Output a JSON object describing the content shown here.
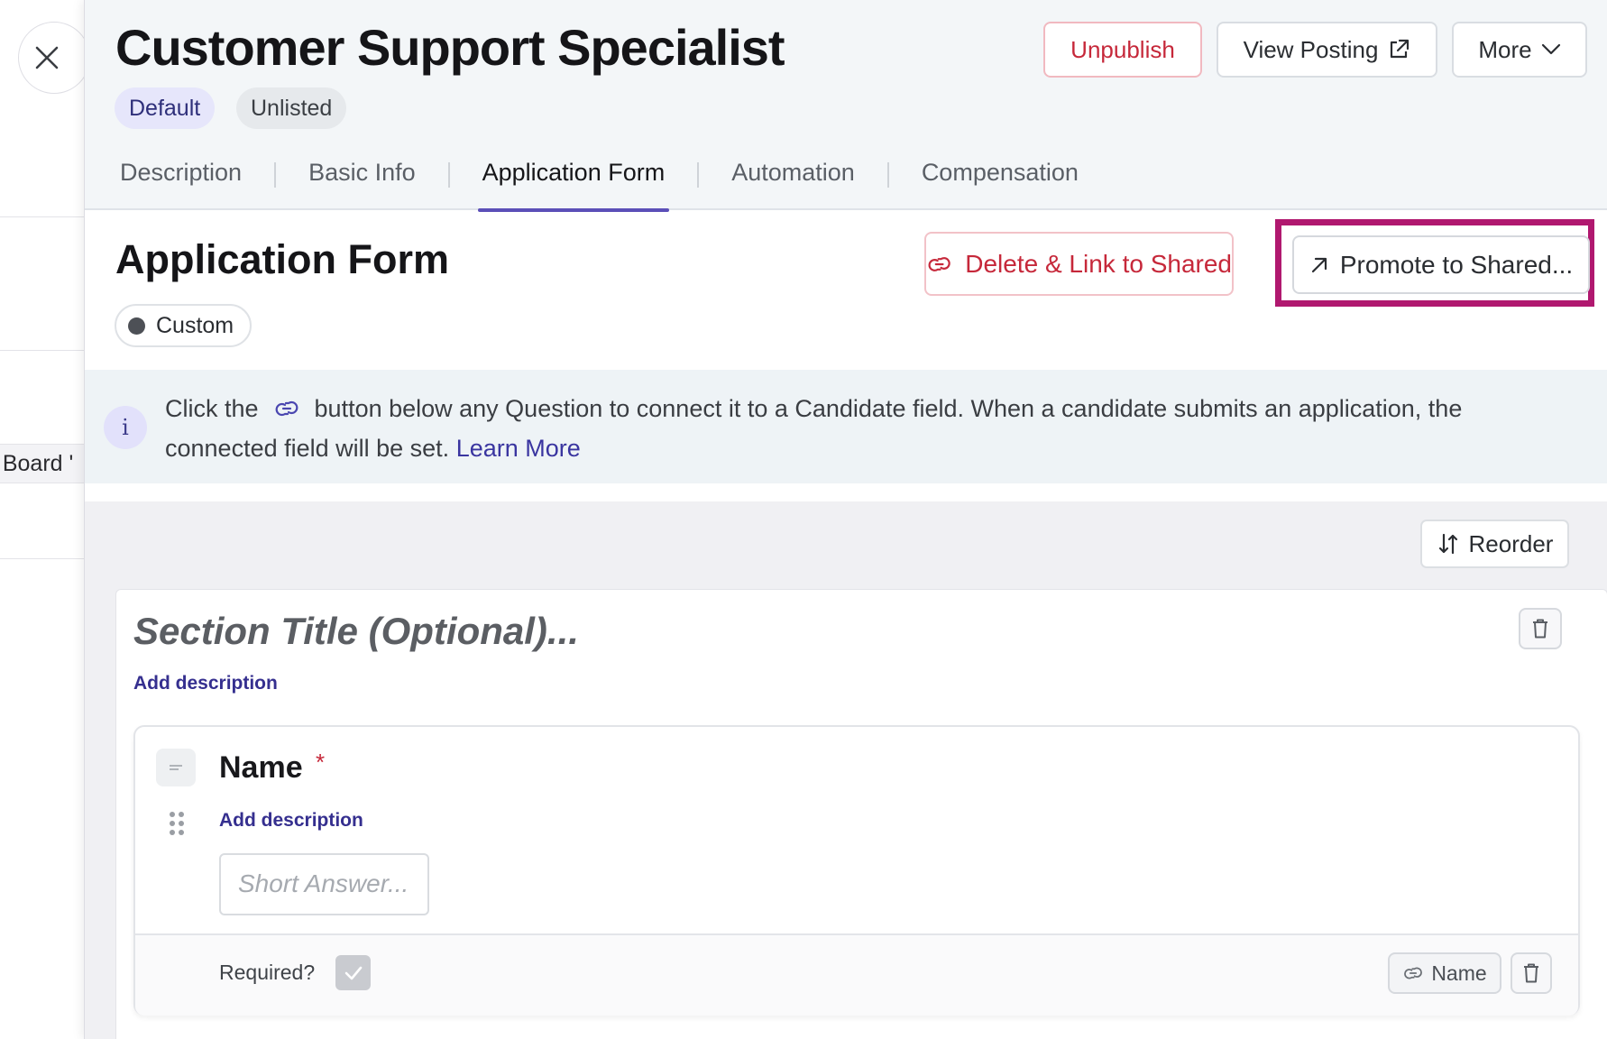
{
  "background": {
    "board_label": "b Board '"
  },
  "header": {
    "title": "Customer Support Specialist",
    "tags": [
      "Default",
      "Unlisted"
    ],
    "buttons": {
      "unpublish": "Unpublish",
      "view_posting": "View Posting",
      "more": "More"
    },
    "tabs": [
      "Description",
      "Basic Info",
      "Application Form",
      "Automation",
      "Compensation"
    ],
    "active_tab": "Application Form"
  },
  "form": {
    "title": "Application Form",
    "status_pill": "Custom",
    "delete_link_label": "Delete & Link to Shared",
    "promote_label": "Promote to Shared...",
    "info": {
      "text_before_icon": "Click the",
      "text_after_icon": "button below any Question to connect it to a Candidate field. When a candidate submits an application, the connected field will be set.",
      "learn_more": "Learn More"
    },
    "reorder_label": "Reorder",
    "section": {
      "title_placeholder": "Section Title (Optional)...",
      "add_description": "Add description",
      "question": {
        "label": "Name",
        "required_marker": "*",
        "add_description": "Add description",
        "answer_placeholder": "Short Answer...",
        "required_label": "Required?",
        "required_checked": true,
        "linked_field": "Name"
      }
    }
  },
  "colors": {
    "accent": "#5b4fb8",
    "danger": "#c6283a",
    "highlight": "#b0186f",
    "link": "#352f8f"
  }
}
